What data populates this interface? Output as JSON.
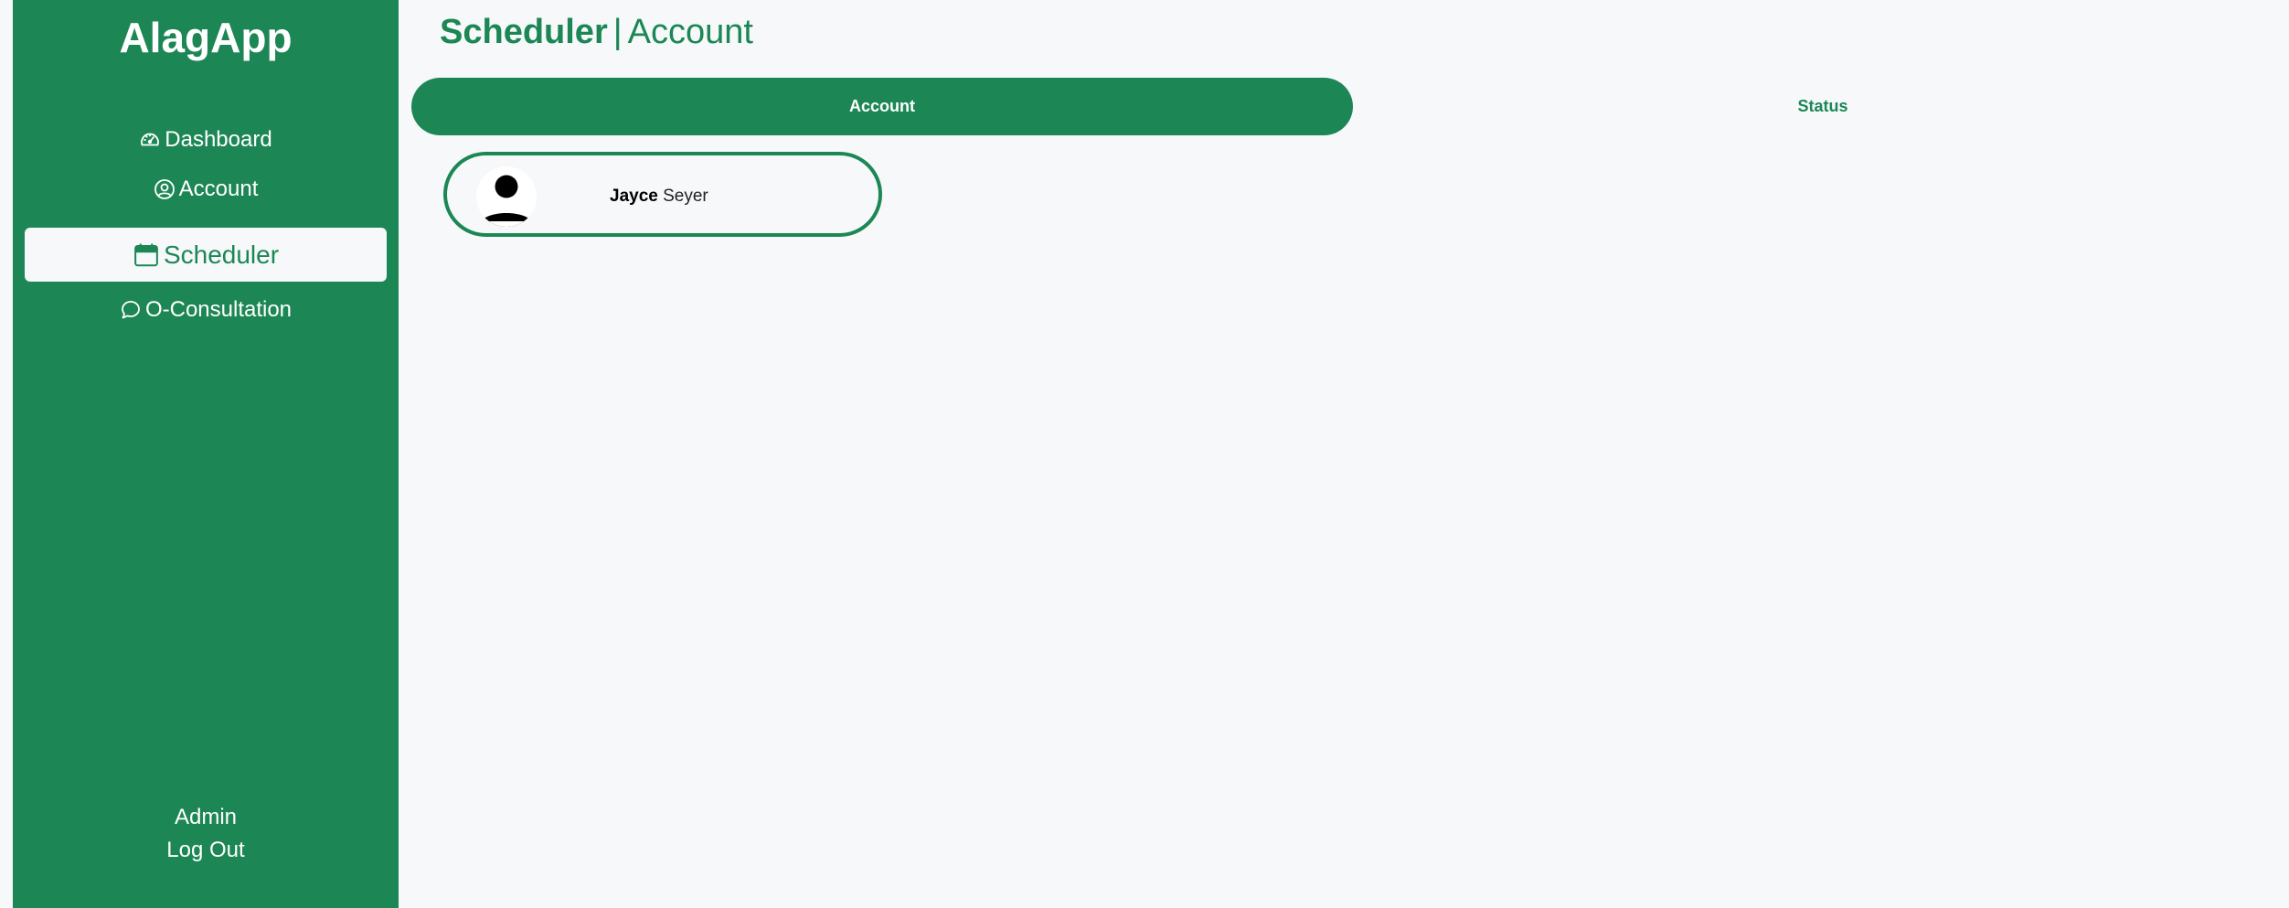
{
  "app": {
    "title": "AlagApp",
    "brand_color": "#1c8755",
    "background_color": "#f6f8fa"
  },
  "sidebar": {
    "items": [
      {
        "label": "Dashboard",
        "icon": "speedometer-icon",
        "active": false
      },
      {
        "label": "Account",
        "icon": "user-circle-icon",
        "active": false
      },
      {
        "label": "Scheduler",
        "icon": "calendar-icon",
        "active": true
      },
      {
        "label": "O-Consultation",
        "icon": "chat-bubble-icon",
        "active": false
      }
    ],
    "user_label": "Admin",
    "logout_label": "Log Out"
  },
  "header": {
    "section": "Scheduler",
    "separator": "|",
    "subsection": "Account"
  },
  "tabs": [
    {
      "label": "Account",
      "active": true
    },
    {
      "label": "Status",
      "active": false
    }
  ],
  "users": [
    {
      "first_name": "Jayce",
      "last_name": "Seyer",
      "avatar_icon": "person-silhouette-icon"
    }
  ]
}
